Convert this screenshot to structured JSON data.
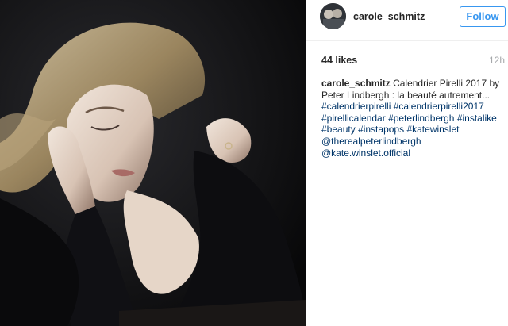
{
  "post": {
    "username": "carole_schmitz",
    "follow_label": "Follow",
    "likes": "44 likes",
    "time": "12h",
    "caption_text": "Calendrier Pirelli 2017 by Peter Lindbergh : la beauté autrement...",
    "hashtags": [
      "#calendrierpirelli",
      "#calendrierpirelli2017",
      "#pirellicalendar",
      "#peterlindbergh",
      "#instalike",
      "#beauty",
      "#instapops",
      "#katewinslet"
    ],
    "mentions": [
      "@therealpeterlindbergh",
      "@kate.winslet.official"
    ]
  },
  "colors": {
    "accent": "#3897f0",
    "link": "#003569",
    "muted": "#a5a7aa",
    "text": "#262626"
  },
  "icons": {
    "avatar": "user-avatar"
  }
}
